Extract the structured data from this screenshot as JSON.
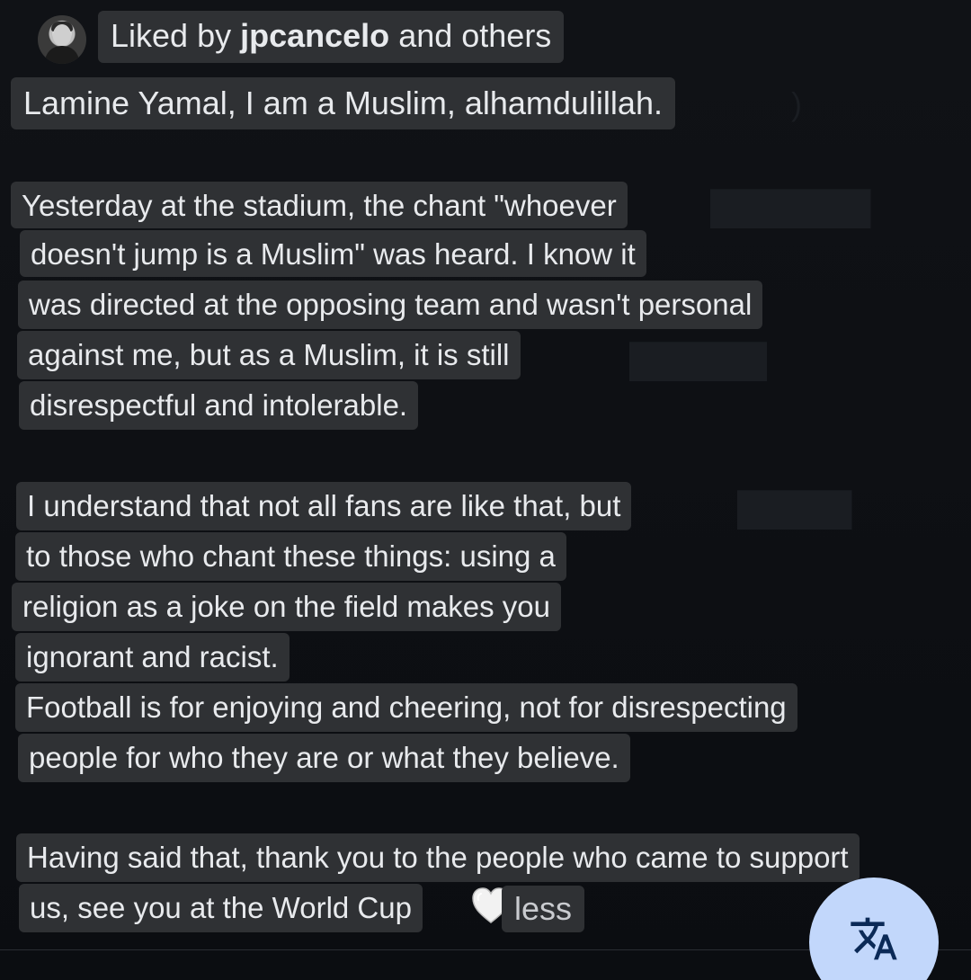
{
  "header": {
    "liked_prefix": "Liked by",
    "liked_user": "jpcancelo",
    "liked_suffix": "and others"
  },
  "post": {
    "lines": [
      "Lamine Yamal, I am a Muslim, alhamdulillah.",
      "Yesterday at the stadium, the chant \"whoever",
      "doesn't jump is a Muslim\" was heard. I know it",
      "was directed at the opposing team and wasn't personal",
      "against me, but as a Muslim, it is still",
      "disrespectful and intolerable.",
      "I understand that not all fans are like that, but",
      "to those who chant these things: using a",
      "religion as a joke on the field makes you",
      "ignorant and racist.",
      "Football is for enjoying and cheering, not for disrespecting",
      "people for who they are or what they believe.",
      "Having said that, thank you to the people who came to support",
      "us, see you at the World Cup"
    ],
    "less_label": "less"
  },
  "icons": {
    "avatar": "user-avatar",
    "heart": "white-heart-icon",
    "translate": "translate-icon"
  },
  "colors": {
    "background": "#0c0e12",
    "chip": "#2f3134",
    "text": "#e8eaed",
    "fab": "#c2d7fb",
    "fab_icon": "#0b2a57"
  }
}
